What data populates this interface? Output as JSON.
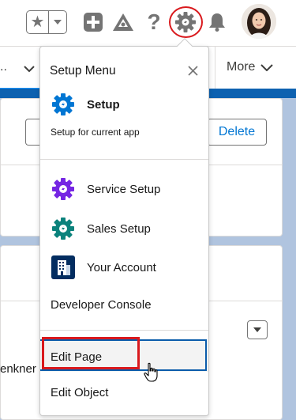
{
  "header": {
    "favorites_star": "★",
    "help_glyph": "?",
    "avatar_alt": "user avatar"
  },
  "nav": {
    "left_tab_label": "..",
    "more_label": "More"
  },
  "page": {
    "delete_label": "Delete",
    "fragment_text": "enkner"
  },
  "menu": {
    "title": "Setup Menu",
    "setup": {
      "label": "Setup",
      "subtitle": "Setup for current app"
    },
    "items": [
      {
        "label": "Service Setup",
        "icon": "service-gear-icon",
        "color": "#7526e3"
      },
      {
        "label": "Sales Setup",
        "icon": "sales-gear-icon",
        "color": "#0b827c"
      },
      {
        "label": "Your Account",
        "icon": "building-icon",
        "color": "#032d60"
      }
    ],
    "developer_console": "Developer Console",
    "edit_page": "Edit Page",
    "edit_object": "Edit Object"
  },
  "colors": {
    "setup_gear": "#0176d3",
    "highlight_red": "#d9191d",
    "link_blue": "#0176d3",
    "focus_blue": "#0b5cab"
  }
}
